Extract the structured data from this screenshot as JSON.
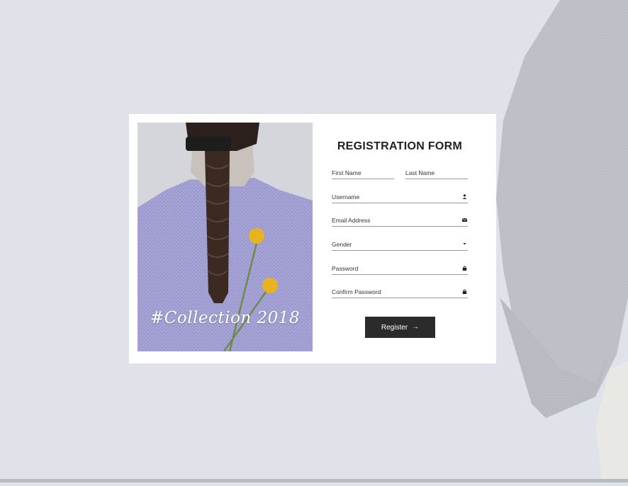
{
  "photo": {
    "caption": "#Collection 2018"
  },
  "form": {
    "title": "REGISTRATION FORM",
    "fields": {
      "first_name": {
        "placeholder": "First Name"
      },
      "last_name": {
        "placeholder": "Last Name"
      },
      "username": {
        "placeholder": "Username",
        "icon": "user-icon"
      },
      "email": {
        "placeholder": "Email Address",
        "icon": "envelope-icon"
      },
      "gender": {
        "placeholder": "Gender",
        "icon": "caret-down-icon"
      },
      "password": {
        "placeholder": "Password",
        "icon": "lock-icon"
      },
      "confirm_password": {
        "placeholder": "Confirm Password",
        "icon": "lock-icon"
      }
    },
    "submit": {
      "label": "Register",
      "icon": "arrow-right-icon"
    }
  },
  "colors": {
    "page_background": "#dfe2e8",
    "card": "#ffffff",
    "button": "#2b2b2b",
    "sweater_lavender": "#a8a5d8",
    "flower_yellow": "#e8b323"
  }
}
